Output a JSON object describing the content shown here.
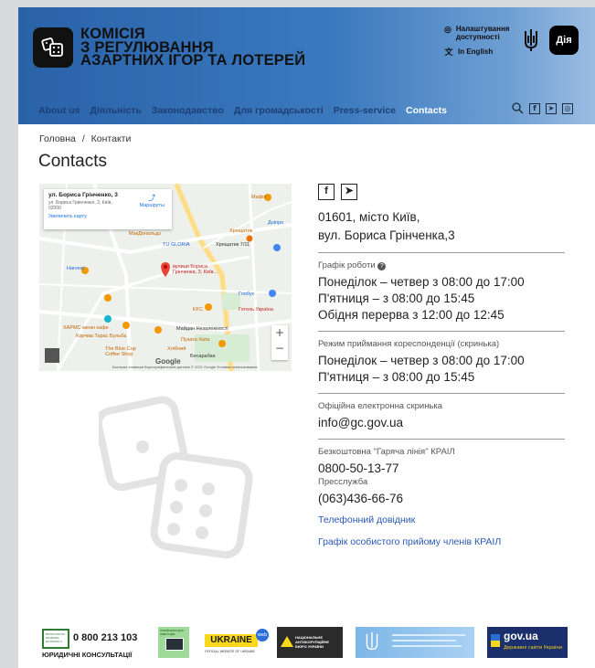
{
  "header": {
    "logo_lines": [
      "КОМІСІЯ",
      "З РЕГУЛЮВАННЯ",
      "АЗАРТНИХ ІГОР ТА ЛОТЕРЕЙ"
    ],
    "accessibility_label": "Налаштування доступності",
    "language_label": "In English",
    "diia_label": "Дія"
  },
  "nav": {
    "items": [
      {
        "label": "About us",
        "active": false
      },
      {
        "label": "Діяльність",
        "active": false
      },
      {
        "label": "Законодавство",
        "active": false
      },
      {
        "label": "Для громадськості",
        "active": false
      },
      {
        "label": "Press-service",
        "active": false
      },
      {
        "label": "Contacts",
        "active": true
      }
    ]
  },
  "breadcrumb": {
    "home": "Головна",
    "separator": "/",
    "current": "Контакти"
  },
  "page_title": "Contacts",
  "map": {
    "card_address": "ул. Бориса Грінченко, 3",
    "card_sub": "ул. Бориса Гринченко, 3, Київ, 02000",
    "card_link": "Увеличить карту",
    "card_route": "Маршруты",
    "pin_label": "вулиця Бориса Грінченка, 3, Київ...",
    "labels": [
      "Мафія",
      "Дніпро",
      "Хрещатик",
      "МакДональдз",
      "TU GLORIA",
      "Хрещатик 7/11",
      "Harvest",
      "Глобус",
      "Готель Україна",
      "KFC",
      "ХАРМС меню кафе",
      "Корчма Тарас Бульба",
      "Майдан Незалежності",
      "Пузата Хата",
      "The Blue Cup Coffee Shop",
      "Хлібний",
      "Бесарабка"
    ],
    "google": "Google",
    "footer": "Быстрые клавиши   Картографические данные © 2021 Google   Условия использования"
  },
  "contacts": {
    "address_line1": "01601, місто Київ,",
    "address_line2": "вул. Бориса Грінченка,3",
    "schedule_label": "Графік роботи",
    "schedule": [
      "Понеділок – четвер з 08:00 до 17:00",
      "П'ятниця – з 08:00 до 15:45",
      "Обідня перерва з 12:00 до 12:45"
    ],
    "mail_label": "Режим приймання кореспонденції (скринька)",
    "mail_schedule": [
      "Понеділок – четвер з 08:00 до 17:00",
      "П'ятниця – з 08:00 до 15:45"
    ],
    "email_label": "Офіційна електронна скринька",
    "email": "info@gc.gov.ua",
    "hotline_label": "Безкоштовна \"Гаряча лінія\" КРАІЛ",
    "hotline": "0800-50-13-77",
    "press_label": "Пресслужба",
    "press_phone": "(063)436-66-76",
    "link_directory": "Телефонний довідник",
    "link_schedule": "Графік особистого прийому членів КРАІЛ"
  },
  "partners": {
    "legal_phone": "0 800 213 103",
    "legal_label": "ЮРИДИЧНІ КОНСУЛЬТАЦІЇ",
    "legal_box_text": "БЕЗОПЛАТНА ПРАВОВА ДОПОМОГА",
    "ukraine_label": "UKRAINE",
    "ukraine_sub": "OFFICIAL WEBSITE OF UKRAINE",
    "ukraine_badge": "web",
    "nazk_label": "НАЦІОНАЛЬНЕ АНТИКОРУПЦІЙНЕ БЮРО УКРАЇНИ",
    "govua_label": "gov.ua",
    "govua_sub": "Державні сайти України",
    "platform_label": "платформа для інвесторів"
  },
  "colors": {
    "header_start": "#2a62a8",
    "header_end": "#9bbde3",
    "nav_text": "#1d3f73",
    "link": "#2a59b8"
  }
}
